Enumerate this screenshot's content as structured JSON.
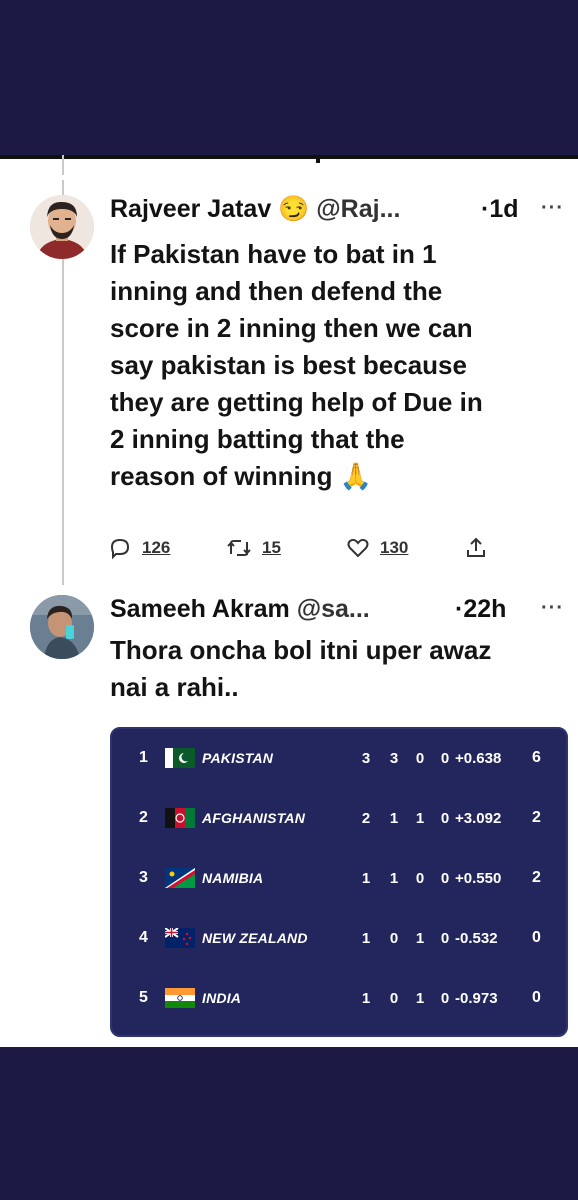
{
  "tweets": [
    {
      "name": "Rajveer Jatav",
      "emoji": "😏",
      "handle": "@Raj...",
      "time": "·1d",
      "more": "···",
      "lines": [
        "If Pakistan have to bat in 1",
        "inning and then defend the",
        "score in 2 inning then we can",
        "say pakistan is best because",
        "they are getting help of Due in",
        "2 inning batting that the",
        "reason of winning 🙏"
      ],
      "replies": "126",
      "retweets": "15",
      "likes": "130"
    },
    {
      "name": "Sameeh Akram",
      "handle": "@sa...",
      "time": "·22h",
      "more": "···",
      "lines": [
        "Thora oncha bol itni uper awaz",
        "nai a rahi.."
      ]
    }
  ],
  "standings": [
    {
      "pos": "1",
      "team": "PAKISTAN",
      "p": "3",
      "w": "3",
      "l": "0",
      "nr": "0",
      "nrr": "+0.638",
      "pts": "6"
    },
    {
      "pos": "2",
      "team": "AFGHANISTAN",
      "p": "2",
      "w": "1",
      "l": "1",
      "nr": "0",
      "nrr": "+3.092",
      "pts": "2"
    },
    {
      "pos": "3",
      "team": "NAMIBIA",
      "p": "1",
      "w": "1",
      "l": "0",
      "nr": "0",
      "nrr": "+0.550",
      "pts": "2"
    },
    {
      "pos": "4",
      "team": "NEW ZEALAND",
      "p": "1",
      "w": "0",
      "l": "1",
      "nr": "0",
      "nrr": "-0.532",
      "pts": "0"
    },
    {
      "pos": "5",
      "team": "INDIA",
      "p": "1",
      "w": "0",
      "l": "1",
      "nr": "0",
      "nrr": "-0.973",
      "pts": "0"
    }
  ]
}
